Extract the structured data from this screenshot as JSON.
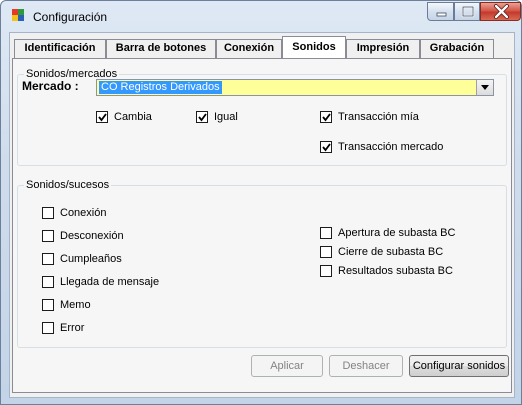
{
  "window": {
    "title": "Configuración",
    "app_icon_text": "SET"
  },
  "tabs": [
    {
      "label": "Identificación",
      "active": false
    },
    {
      "label": "Barra de botones",
      "active": false
    },
    {
      "label": "Conexión",
      "active": false
    },
    {
      "label": "Sonidos",
      "active": true
    },
    {
      "label": "Impresión",
      "active": false
    },
    {
      "label": "Grabación",
      "active": false
    }
  ],
  "mercados_group": {
    "title": "Sonidos/mercados",
    "mercado_label": "Mercado :",
    "mercado_value": "CO Registros Derivados",
    "combo_color": "#ffff99",
    "checkboxes": [
      {
        "label": "Cambia",
        "checked": true
      },
      {
        "label": "Igual",
        "checked": true
      },
      {
        "label": "Transacción mía",
        "checked": true
      },
      {
        "label": "Transacción mercado",
        "checked": true
      }
    ]
  },
  "sucesos_group": {
    "title": "Sonidos/sucesos",
    "left_checkboxes": [
      {
        "label": "Conexión",
        "checked": false
      },
      {
        "label": "Desconexión",
        "checked": false
      },
      {
        "label": "Cumpleaños",
        "checked": false
      },
      {
        "label": "Llegada de mensaje",
        "checked": false
      },
      {
        "label": "Memo",
        "checked": false
      },
      {
        "label": "Error",
        "checked": false
      }
    ],
    "right_checkboxes": [
      {
        "label": "Apertura de subasta BC",
        "checked": false
      },
      {
        "label": "Cierre de subasta BC",
        "checked": false
      },
      {
        "label": "Resultados subasta BC",
        "checked": false
      }
    ]
  },
  "buttons": {
    "aplicar": "Aplicar",
    "deshacer": "Deshacer",
    "configurar": "Configurar sonidos"
  }
}
